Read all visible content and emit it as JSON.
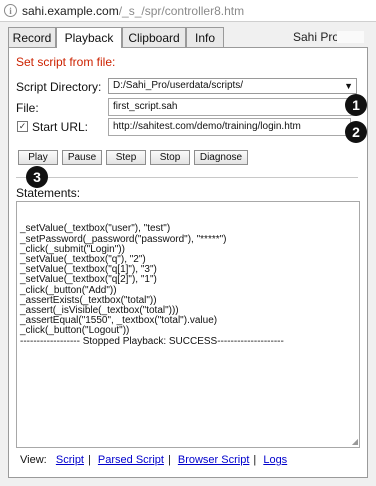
{
  "address_bar": {
    "host": "sahi.example.com",
    "path": "/_s_/spr/controller8.htm"
  },
  "tabs": [
    {
      "label": "Record",
      "active": false
    },
    {
      "label": "Playback",
      "active": true
    },
    {
      "label": "Clipboard",
      "active": false
    },
    {
      "label": "Info",
      "active": false
    }
  ],
  "brand": "Sahi Pro",
  "playback": {
    "heading": "Set script from file:",
    "script_directory_label": "Script Directory:",
    "script_directory_value": "D:/Sahi_Pro/userdata/scripts/",
    "file_label": "File:",
    "file_value": "first_script.sah",
    "start_url_label": "Start URL:",
    "start_url_checked": true,
    "start_url_value": "http://sahitest.com/demo/training/login.htm",
    "buttons": {
      "play": "Play",
      "pause": "Pause",
      "step": "Step",
      "stop": "Stop",
      "diagnose": "Diagnose"
    },
    "statements_label": "Statements:",
    "statements": [
      "_setValue(_textbox(\"user\"), \"test\")",
      "_setPassword(_password(\"password\"), \"*****\")",
      "_click(_submit(\"Login\"))",
      "_setValue(_textbox(\"q\"), \"2\")",
      "_setValue(_textbox(\"q[1]\"), \"3\")",
      "_setValue(_textbox(\"q[2]\"), \"1\")",
      "_click(_button(\"Add\"))",
      "_assertExists(_textbox(\"total\"))",
      "_assert(_isVisible(_textbox(\"total\")))",
      "_assertEqual(\"1550\", _textbox(\"total\").value)",
      "_click(_button(\"Logout\"))",
      "------------------ Stopped Playback: SUCCESS--------------------"
    ],
    "view_label": "View:",
    "view_links": [
      "Script",
      "Parsed Script",
      "Browser Script",
      "Logs"
    ]
  },
  "markers": [
    "1",
    "2",
    "3"
  ],
  "colors": {
    "heading": "#cc2200",
    "link": "#0000cc",
    "marker": "#111111"
  },
  "icons": {
    "address_info": "info-icon",
    "select_arrow": "dropdown-arrow-icon",
    "checkbox": "checkmark-icon"
  }
}
